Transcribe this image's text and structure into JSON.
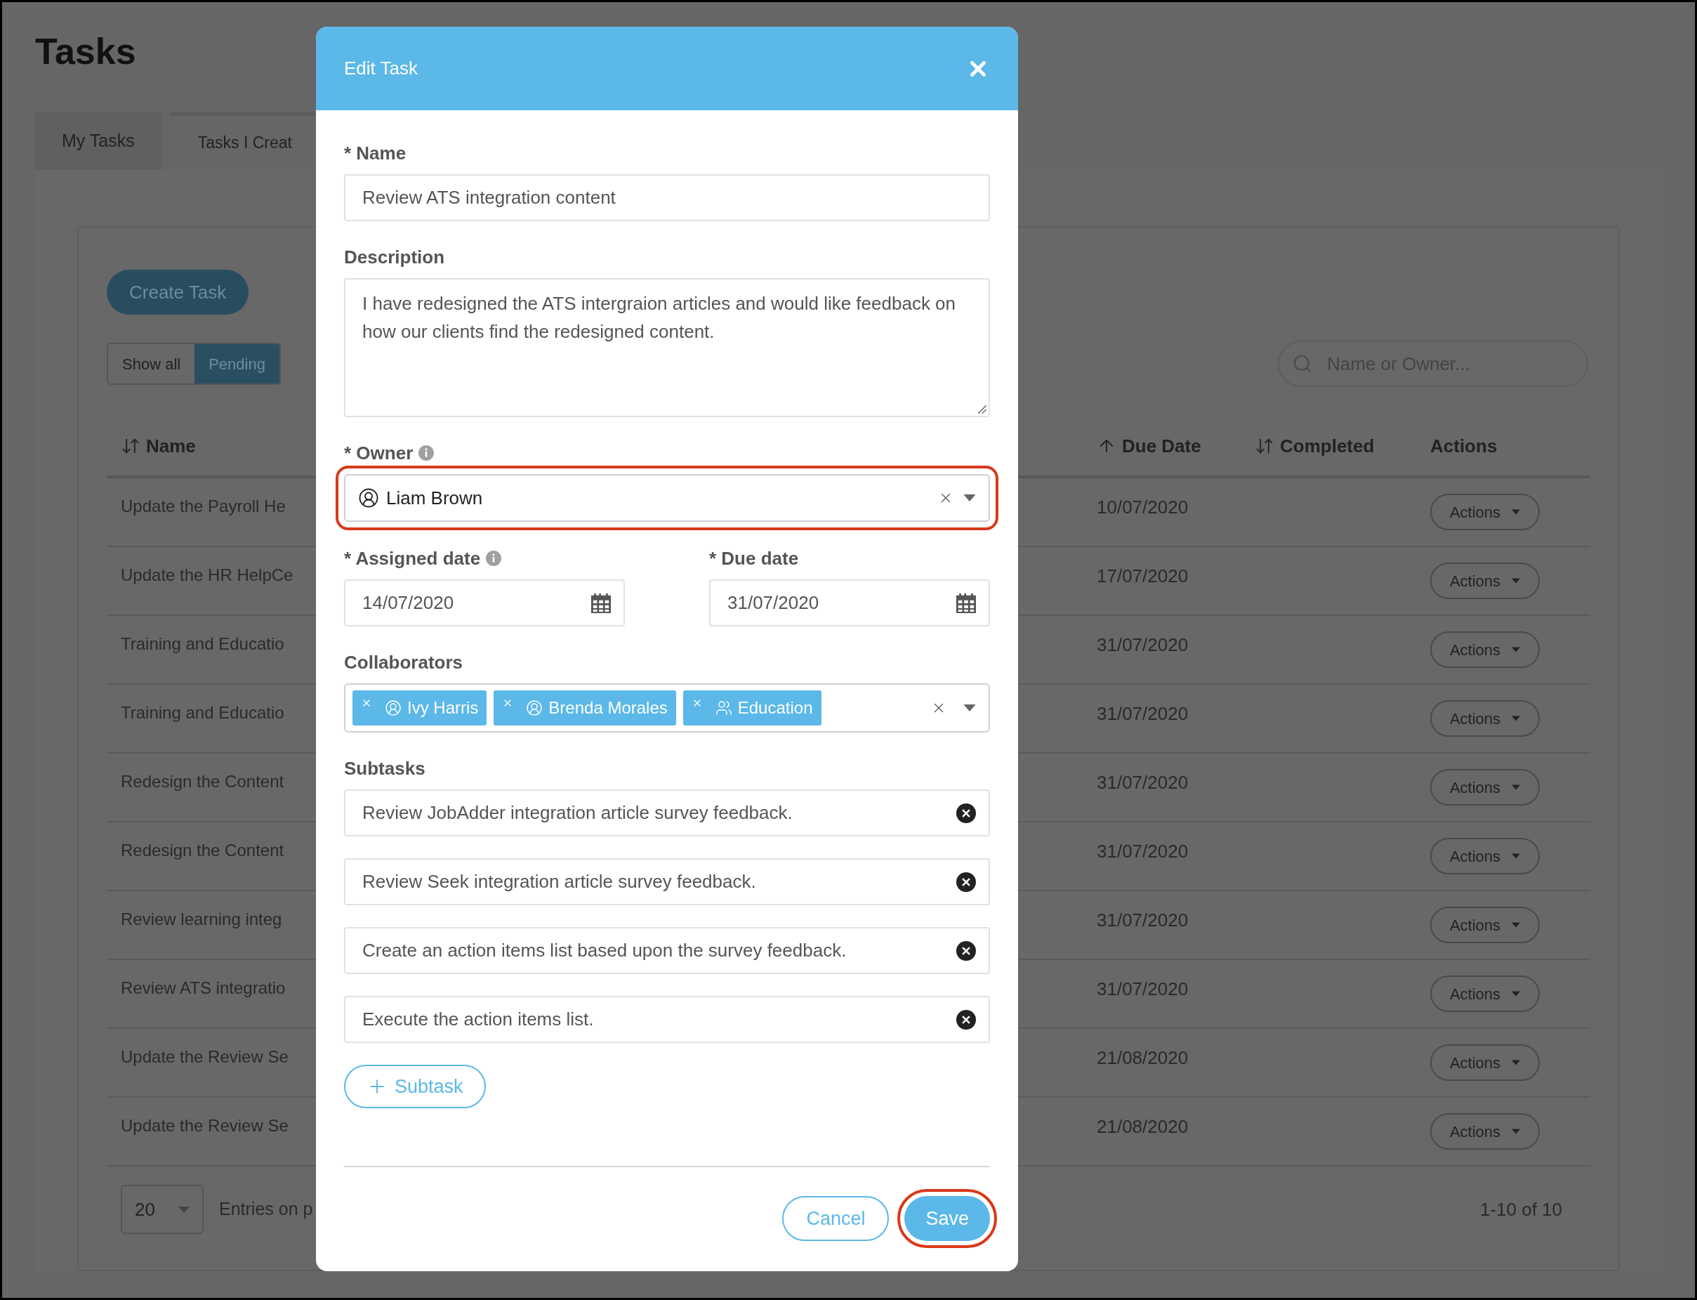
{
  "page": {
    "title": "Tasks"
  },
  "tabs": [
    {
      "label": "My Tasks",
      "selected": false
    },
    {
      "label": "Tasks I Creat",
      "selected": true
    }
  ],
  "create_button": "Create Task",
  "filters": [
    {
      "label": "Show all",
      "selected": false
    },
    {
      "label": "Pending",
      "selected": true
    }
  ],
  "search": {
    "placeholder": "Name or Owner..."
  },
  "table": {
    "columns": [
      {
        "label": "Name",
        "kind": "sortable"
      },
      {
        "label": "Due Date",
        "kind": "ascending"
      },
      {
        "label": "Completed",
        "kind": "sortable"
      },
      {
        "label": "Actions",
        "kind": "plain"
      }
    ],
    "rows": [
      {
        "name": "Update the Payroll He",
        "due": "10/07/2020",
        "action": "Actions"
      },
      {
        "name": "Update the HR HelpCe",
        "due": "17/07/2020",
        "action": "Actions"
      },
      {
        "name": "Training and Educatio",
        "due": "31/07/2020",
        "action": "Actions"
      },
      {
        "name": "Training and Educatio",
        "due": "31/07/2020",
        "action": "Actions"
      },
      {
        "name": "Redesign the Content",
        "due": "31/07/2020",
        "action": "Actions"
      },
      {
        "name": "Redesign the Content",
        "due": "31/07/2020",
        "action": "Actions"
      },
      {
        "name": "Review learning integ",
        "due": "31/07/2020",
        "action": "Actions"
      },
      {
        "name": "Review ATS integratio",
        "due": "31/07/2020",
        "action": "Actions"
      },
      {
        "name": "Update the Review Se",
        "due": "21/08/2020",
        "action": "Actions"
      },
      {
        "name": "Update the Review Se",
        "due": "21/08/2020",
        "action": "Actions"
      }
    ]
  },
  "pagination": {
    "page_size": "20",
    "entries_label": "Entries on p",
    "range": "1-10 of 10"
  },
  "modal": {
    "title": "Edit Task",
    "name": {
      "label": "* Name",
      "value": "Review ATS integration content"
    },
    "description": {
      "label": "Description",
      "value": "I have redesigned the ATS intergraion articles and would like feedback on how our clients find the redesigned content."
    },
    "owner": {
      "label": "* Owner",
      "info": true,
      "value": "Liam Brown",
      "highlighted": true
    },
    "assigned_date": {
      "label": "* Assigned date",
      "info": true,
      "value": "14/07/2020"
    },
    "due_date": {
      "label": "* Due date",
      "info": false,
      "value": "31/07/2020"
    },
    "collaborators": {
      "label": "Collaborators",
      "tags": [
        {
          "label": "Ivy Harris",
          "kind": "person"
        },
        {
          "label": "Brenda Morales",
          "kind": "person"
        },
        {
          "label": "Education",
          "kind": "group"
        }
      ]
    },
    "subtasks": {
      "label": "Subtasks",
      "items": [
        "Review JobAdder integration article survey feedback.",
        "Review Seek integration article survey feedback.",
        "Create an action items list based upon the survey feedback.",
        "Execute the action items list."
      ]
    },
    "add_subtask": "Subtask",
    "cancel": "Cancel",
    "save": {
      "label": "Save",
      "highlighted": true
    }
  }
}
